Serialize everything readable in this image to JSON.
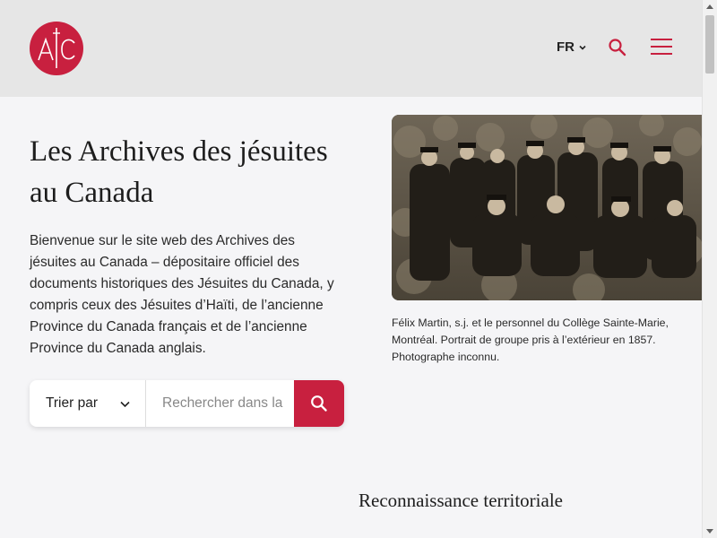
{
  "header": {
    "logo_text": "AJC",
    "language": "FR",
    "search_icon": "search-icon",
    "menu_icon": "hamburger-menu-icon"
  },
  "hero": {
    "title": "Les Archives des jésuites au Canada",
    "intro": "Bienvenue sur le site web des Archives des jésuites au Canada – dépositaire officiel des documents historiques des Jésuites du Canada, y compris ceux des Jésuites d’Haïti, de l’ancienne Province du Canada français et de l’ancienne Province du Canada anglais."
  },
  "search": {
    "sort_label": "Trier par",
    "placeholder": "Rechercher dans la",
    "submit_icon": "search-icon"
  },
  "photo": {
    "caption": "Félix Martin, s.j. et le personnel du Collège Sainte-Marie, Montréal. Portrait de groupe pris à l’extérieur en 1857. Photographe inconnu."
  },
  "next_section": {
    "title": "Reconnaissance territoriale"
  },
  "colors": {
    "accent": "#c8203f",
    "header_bg": "#e6e6e6",
    "page_bg": "#f5f5f7"
  }
}
